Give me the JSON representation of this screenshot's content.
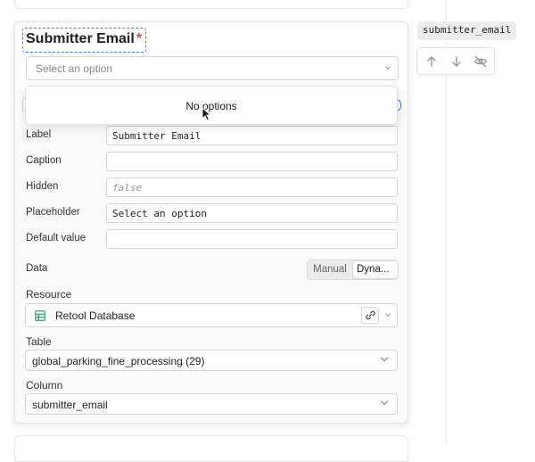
{
  "field_card": {
    "title": "Submitter Email",
    "required_marker": "*",
    "select_placeholder": "Select an option",
    "dropdown_empty": "No options"
  },
  "inspector": {
    "rows": [
      {
        "label": "Label",
        "value": "Submitter Email"
      },
      {
        "label": "Caption",
        "value": ""
      },
      {
        "label": "Hidden",
        "value": "false"
      },
      {
        "label": "Placeholder",
        "value": "Select an option"
      },
      {
        "label": "Default value",
        "value": ""
      }
    ],
    "data": {
      "label": "Data",
      "options": [
        "Manual",
        "Dyna..."
      ],
      "selected": "Dyna..."
    },
    "resource": {
      "label": "Resource",
      "value": "Retool Database",
      "icon": "table-icon"
    },
    "table": {
      "label": "Table",
      "value": "global_parking_fine_processing (29)"
    },
    "column": {
      "label": "Column",
      "value": "submitter_email"
    }
  },
  "side_panel": {
    "key_name": "submitter_email",
    "actions": [
      "arrow-up-icon",
      "arrow-down-icon",
      "eye-off-icon"
    ]
  },
  "colors": {
    "accent": "#3b82f6",
    "required": "#e5484d",
    "resource_icon": "#2f9e6e"
  }
}
